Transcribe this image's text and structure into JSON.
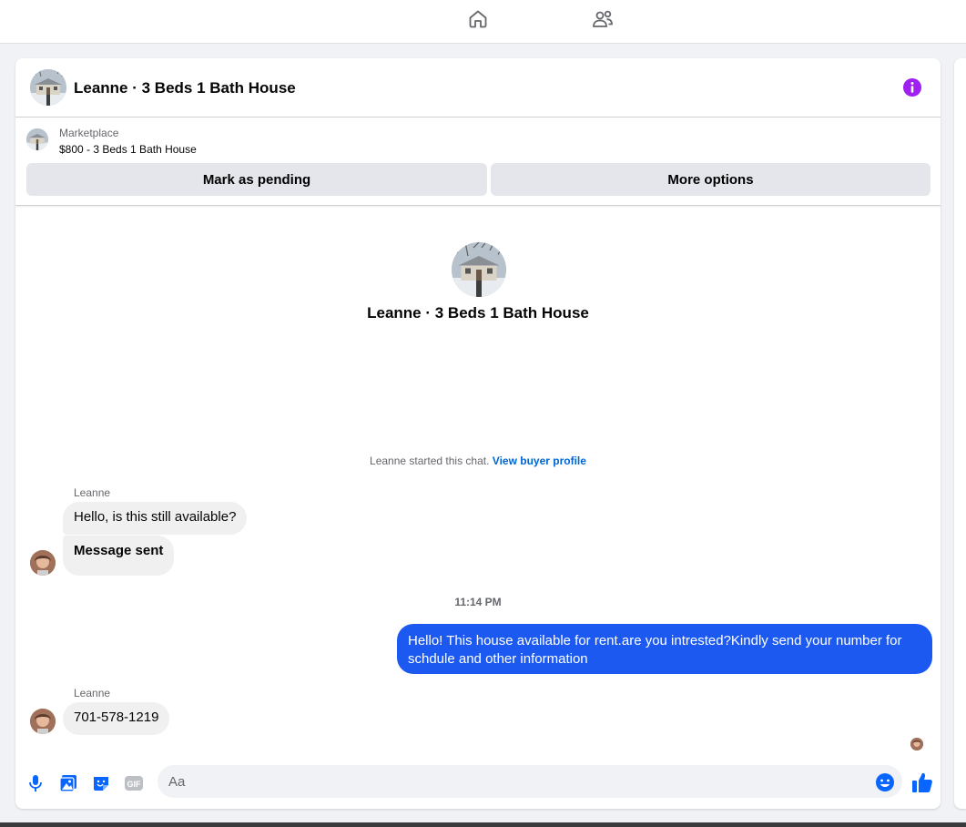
{
  "colors": {
    "accent": "#0866ff",
    "outgoing_bubble": "#1c59f0",
    "info_icon": "#a020f0",
    "incoming_bubble": "#f0f0f0"
  },
  "topbar": {
    "home_icon": "home-icon",
    "people_icon": "people-icon"
  },
  "header": {
    "title": "Leanne · 3 Beds 1 Bath House",
    "info_icon": "info-icon"
  },
  "listing": {
    "category": "Marketplace",
    "summary": "$800 - 3 Beds 1 Bath House",
    "pending_label": "Mark as pending",
    "more_label": "More options"
  },
  "conversation": {
    "title": "Leanne · 3 Beds 1 Bath House",
    "started_text": "Leanne started this chat.",
    "started_link": "View buyer profile",
    "messages": [
      {
        "sender": "Leanne",
        "text": "Hello, is this still available?"
      },
      {
        "sender": "Leanne",
        "text": "Message sent"
      },
      {
        "timestamp": "11:14 PM"
      },
      {
        "sender": "me",
        "text": "Hello! This house available for rent.are you intrested?Kindly send your number for schdule and other information"
      },
      {
        "sender": "Leanne",
        "text": "701-578-1219"
      }
    ]
  },
  "composer": {
    "placeholder": "Aa",
    "icons": [
      "microphone-icon",
      "photo-icon",
      "sticker-icon",
      "gif-icon",
      "emoji-icon",
      "like-icon"
    ]
  }
}
